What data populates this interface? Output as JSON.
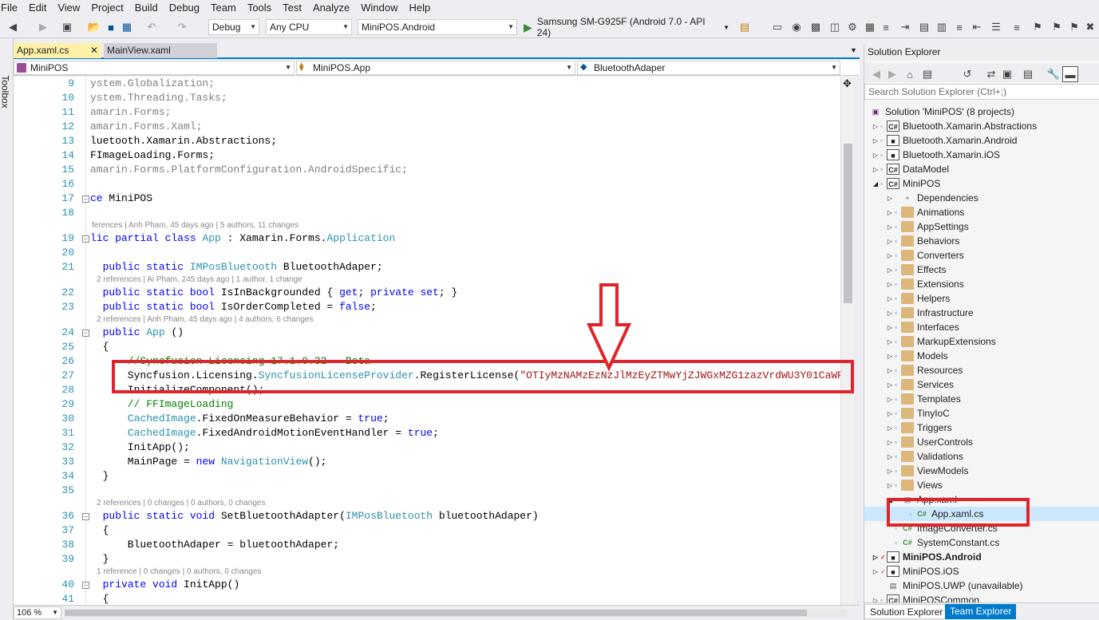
{
  "menu": [
    "File",
    "Edit",
    "View",
    "Project",
    "Build",
    "Debug",
    "Team",
    "Tools",
    "Test",
    "Analyze",
    "Window",
    "Help"
  ],
  "toolbar": {
    "config": "Debug",
    "platform": "Any CPU",
    "startup": "MiniPOS.Android",
    "run_target": "Samsung SM-G925F (Android 7.0 - API 24)"
  },
  "toolbox_label": "Toolbox",
  "tabs": [
    {
      "label": "App.xaml.cs",
      "close": "✕",
      "active": true
    },
    {
      "label": "MainView.xaml",
      "active": false
    }
  ],
  "navbar": {
    "project": "MiniPOS",
    "class": "MiniPOS.App",
    "member": "BluetoothAdaper"
  },
  "lines": [
    {
      "n": "9",
      "html": "<span class=\"gr\">ystem.Globalization;</span>"
    },
    {
      "n": "10",
      "html": "<span class=\"gr\">ystem.Threading.Tasks;</span>"
    },
    {
      "n": "11",
      "html": "<span class=\"gr\">amarin.Forms;</span>"
    },
    {
      "n": "12",
      "html": "<span class=\"gr\">amarin.Forms.Xaml;</span>"
    },
    {
      "n": "13",
      "html": "luetooth.Xamarin.Abstractions;"
    },
    {
      "n": "14",
      "html": "FImageLoading.Forms;"
    },
    {
      "n": "15",
      "html": "<span class=\"gr\">amarin.Forms.PlatformConfiguration.AndroidSpecific;</span>"
    },
    {
      "n": "16",
      "html": ""
    },
    {
      "n": "17",
      "html": "ce MiniPOS"
    },
    {
      "n": "18",
      "html": ""
    }
  ],
  "code_lines": [
    {
      "n": "9",
      "text": "ystem.Globalization;"
    },
    {
      "n": "10",
      "text": "ystem.Threading.Tasks;"
    },
    {
      "n": "11",
      "text": "amarin.Forms;"
    },
    {
      "n": "12",
      "text": "amarin.Forms.Xaml;"
    },
    {
      "n": "13",
      "text": "luetooth.Xamarin.Abstractions;"
    },
    {
      "n": "14",
      "text": "FImageLoading.Forms;"
    },
    {
      "n": "15",
      "text": "amarin.Forms.PlatformConfiguration.AndroidSpecific;"
    },
    {
      "n": "16",
      "text": ""
    },
    {
      "n": "17",
      "text": "ce MiniPOS"
    },
    {
      "n": "18",
      "text": ""
    },
    {
      "n": "19",
      "text": "lic partial class App : Xamarin.Forms.Application"
    },
    {
      "n": "20",
      "text": ""
    },
    {
      "n": "21",
      "text": "  public static IMPosBluetooth BluetoothAdaper;"
    },
    {
      "n": "22",
      "text": "  public static bool IsInBackgrounded { get; private set; }"
    },
    {
      "n": "23",
      "text": "  public static bool IsOrderCompleted = false;"
    },
    {
      "n": "24",
      "text": "  public App ()"
    },
    {
      "n": "25",
      "text": "  {"
    },
    {
      "n": "26",
      "text": "      //Syncfusion Licensing 17.1.0.32 - Beta"
    },
    {
      "n": "27",
      "text": "      Syncfusion.Licensing.SyncfusionLicenseProvider.RegisterLicense(\"OTIyMzNAMzEzNzJlMzEyZTMwYjZJWGxMZG1zazVrdWU3Y01CaWRuYUl"
    },
    {
      "n": "28",
      "text": "      InitializeComponent();"
    },
    {
      "n": "29",
      "text": "      // FFImageLoading"
    },
    {
      "n": "30",
      "text": "      CachedImage.FixedOnMeasureBehavior = true;"
    },
    {
      "n": "31",
      "text": "      CachedImage.FixedAndroidMotionEventHandler = true;"
    },
    {
      "n": "32",
      "text": "      InitApp();"
    },
    {
      "n": "33",
      "text": "      MainPage = new NavigationView();"
    },
    {
      "n": "34",
      "text": "  }"
    },
    {
      "n": "35",
      "text": ""
    },
    {
      "n": "36",
      "text": "  public static void SetBluetoothAdapter(IMPosBluetooth bluetoothAdaper)"
    },
    {
      "n": "37",
      "text": "  {"
    },
    {
      "n": "38",
      "text": "      BluetoothAdaper = bluetoothAdaper;"
    },
    {
      "n": "39",
      "text": "  }"
    },
    {
      "n": "40",
      "text": "  private void InitApp()"
    },
    {
      "n": "41",
      "text": "  {"
    }
  ],
  "lens": {
    "app_class": "ferences | Anh Pham, 45 days ago | 5 authors, 11 changes",
    "bluetooth": "2 references | Ai Pham, 245 days ago | 1 author, 1 change",
    "ctor": "2 references | Anh Pham, 45 days ago | 4 authors, 6 changes",
    "setbt": "2 references | 0 changes | 0 authors, 0 changes",
    "initapp": "1 reference | 0 changes | 0 authors, 0 changes"
  },
  "zoom": "106 %",
  "solution_explorer": {
    "title": "Solution Explorer",
    "search_placeholder": "Search Solution Explorer (Ctrl+;)",
    "solution": "Solution 'MiniPOS' (8 projects)",
    "projects_top": [
      "Bluetooth.Xamarin.Abstractions",
      "Bluetooth.Xamarin.Android",
      "Bluetooth.Xamarin.iOS",
      "DataModel"
    ],
    "minipos": "MiniPOS",
    "minipos_children": [
      "Dependencies",
      "Animations",
      "AppSettings",
      "Behaviors",
      "Converters",
      "Effects",
      "Extensions",
      "Helpers",
      "Infrastructure",
      "Interfaces",
      "MarkupExtensions",
      "Models",
      "Resources",
      "Services",
      "Templates",
      "TinyIoC",
      "Triggers",
      "UserControls",
      "Validations",
      "ViewModels",
      "Views"
    ],
    "app_xaml": "App.xaml",
    "app_xaml_cs": "App.xaml.cs",
    "files": [
      "ImageConverter.cs",
      "SystemConstant.cs"
    ],
    "projects_bottom": [
      "MiniPOS.Android",
      "MiniPOS.iOS",
      "MiniPOS.UWP (unavailable)",
      "MiniPOSCommon"
    ],
    "bottom_tabs": [
      "Solution Explorer",
      "Team Explorer"
    ]
  },
  "colors": {
    "highlight": "#e0242b",
    "accent": "#007acc"
  }
}
